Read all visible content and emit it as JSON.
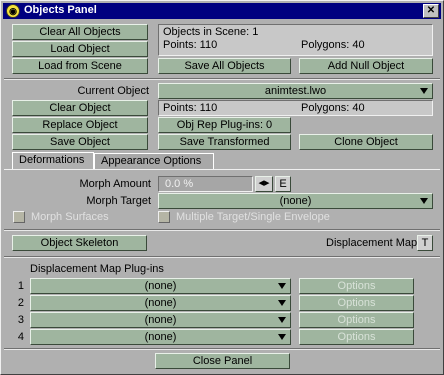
{
  "window": {
    "title": "Objects Panel",
    "close_glyph": "✕",
    "app_icon": "lightwave-icon"
  },
  "top": {
    "clear_all": "Clear All Objects",
    "load_object": "Load Object",
    "load_from_scene": "Load from Scene",
    "save_all": "Save All Objects",
    "add_null": "Add Null Object",
    "scene_info": {
      "objects": "Objects in Scene: 1",
      "points": "Points: 110",
      "polygons": "Polygons: 40"
    }
  },
  "current": {
    "label": "Current Object",
    "value": "animtest.lwo",
    "clear": "Clear Object",
    "points": "Points: 110",
    "polygons": "Polygons: 40",
    "replace": "Replace Object",
    "plugins": "Obj Rep Plug-ins: 0",
    "save": "Save Object",
    "save_transformed": "Save Transformed",
    "clone": "Clone Object"
  },
  "tabs": [
    {
      "label": "Deformations"
    },
    {
      "label": "Appearance Options"
    }
  ],
  "deform": {
    "morph_amount_label": "Morph Amount",
    "morph_amount_value": "0.0 %",
    "e_label": "E",
    "morph_target_label": "Morph Target",
    "morph_target_value": "(none)",
    "morph_surfaces": "Morph Surfaces",
    "multiple_target": "Multiple Target/Single Envelope",
    "skeleton": "Object Skeleton",
    "displacement_map": "Displacement Map",
    "t_label": "T",
    "plugins_label": "Displacement Map Plug-ins",
    "plugins": [
      {
        "num": "1",
        "value": "(none)",
        "options": "Options"
      },
      {
        "num": "2",
        "value": "(none)",
        "options": "Options"
      },
      {
        "num": "3",
        "value": "(none)",
        "options": "Options"
      },
      {
        "num": "4",
        "value": "(none)",
        "options": "Options"
      }
    ]
  },
  "footer": {
    "close": "Close Panel"
  }
}
